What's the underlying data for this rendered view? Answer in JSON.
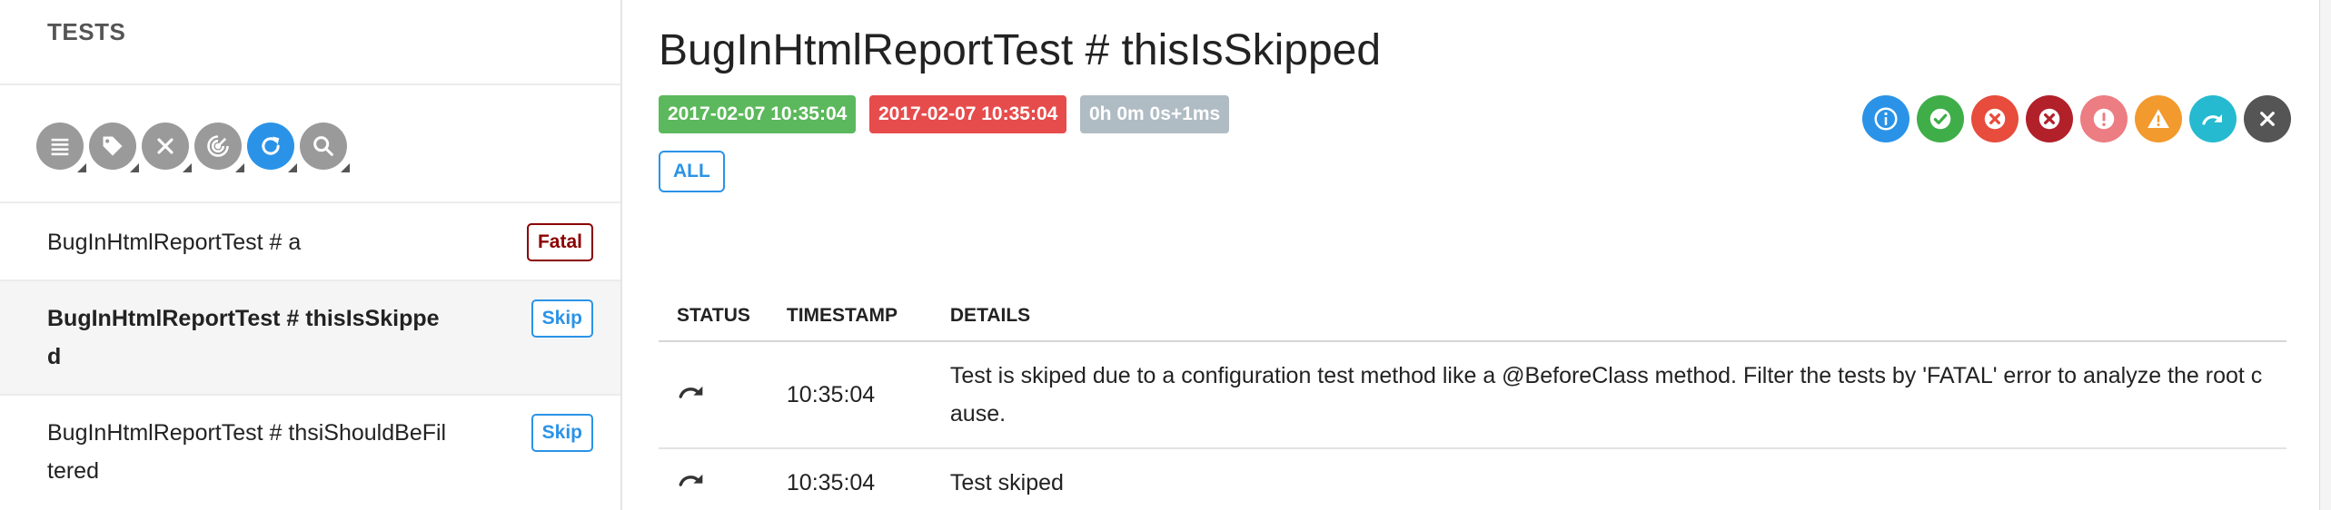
{
  "sidebar": {
    "header": "TESTS",
    "tools": [
      {
        "icon": "list-icon"
      },
      {
        "icon": "tag-icon"
      },
      {
        "icon": "close-icon"
      },
      {
        "icon": "dashboard-icon"
      },
      {
        "icon": "refresh-icon"
      },
      {
        "icon": "search-icon"
      }
    ],
    "tests": [
      {
        "name": "BugInHtmlReportTest # a",
        "status": "Fatal"
      },
      {
        "name": "BugInHtmlReportTest # thisIsSkipped",
        "status": "Skip"
      },
      {
        "name": "BugInHtmlReportTest # thsiShouldBeFiltered",
        "status": "Skip"
      }
    ]
  },
  "detail": {
    "title": "BugInHtmlReportTest # thisIsSkipped",
    "start_time": "2017-02-07 10:35:04",
    "end_time": "2017-02-07 10:35:04",
    "duration": "0h 0m 0s+1ms",
    "all_label": "ALL",
    "status_filters": [
      {
        "icon": "info-icon",
        "color": "#2a93e8"
      },
      {
        "icon": "check-icon",
        "color": "#3fae49"
      },
      {
        "icon": "x-circle-icon",
        "color": "#e74c3c"
      },
      {
        "icon": "x-circle-icon",
        "color": "#b2202a"
      },
      {
        "icon": "exclamation-icon",
        "color": "#ec7d83"
      },
      {
        "icon": "warning-icon",
        "color": "#f29a2e"
      },
      {
        "icon": "skip-arrow-icon",
        "color": "#26bad0"
      },
      {
        "icon": "close-icon",
        "color": "#555555"
      }
    ],
    "log": {
      "headers": [
        "STATUS",
        "TIMESTAMP",
        "DETAILS"
      ],
      "rows": [
        {
          "status_icon": "skip-arrow-icon",
          "timestamp": "10:35:04",
          "details": "Test is skiped due to a configuration test method like a @BeforeClass method. Filter the tests by 'FATAL' error to analyze the root cause."
        },
        {
          "status_icon": "skip-arrow-icon",
          "timestamp": "10:35:04",
          "details": "Test skiped"
        }
      ]
    }
  }
}
